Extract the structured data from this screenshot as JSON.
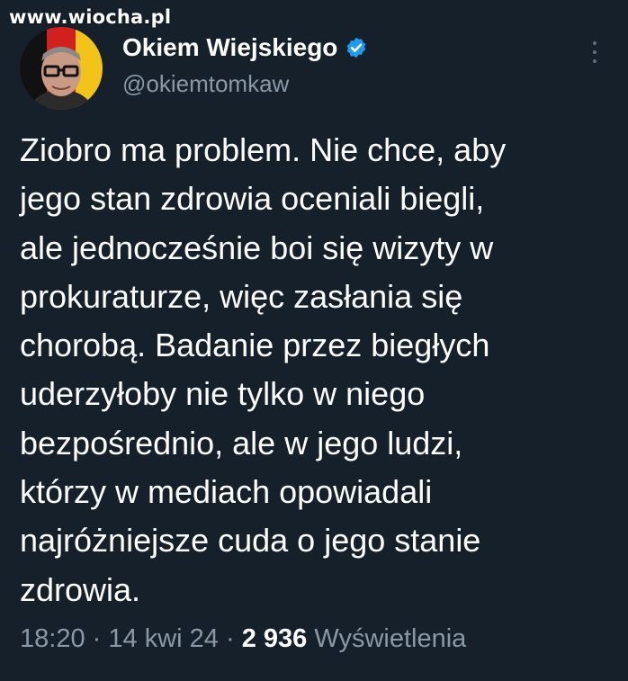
{
  "watermark": "www.wiocha.pl",
  "tweet": {
    "author": {
      "name": "Okiem Wiejskiego",
      "handle": "@okiemtomkaw",
      "verified_icon": "verified-badge-icon",
      "avatar": "avatar"
    },
    "more_icon": "more-options-icon",
    "text": "Ziobro ma problem. Nie chce, aby\njego stan zdrowia oceniali biegli,\nale jednocześnie boi się wizyty w\nprokuraturze, więc zasłania się\nchorobą. Badanie przez biegłych\nuderzyłoby nie tylko w niego\nbezpośrednio, ale w jego ludzi,\nktórzy w mediach opowiadali\nnajróżniejsze cuda o jego stanie\nzdrowia.",
    "meta": {
      "time": "18:20",
      "date": "14 kwi 24",
      "separator": "·",
      "views_count": "2 936",
      "views_label": "Wyświetlenia"
    }
  },
  "colors": {
    "background": "#15202b",
    "text_primary": "#ffffff",
    "text_secondary": "#8b98a5",
    "verified_blue": "#1d9bf0"
  }
}
